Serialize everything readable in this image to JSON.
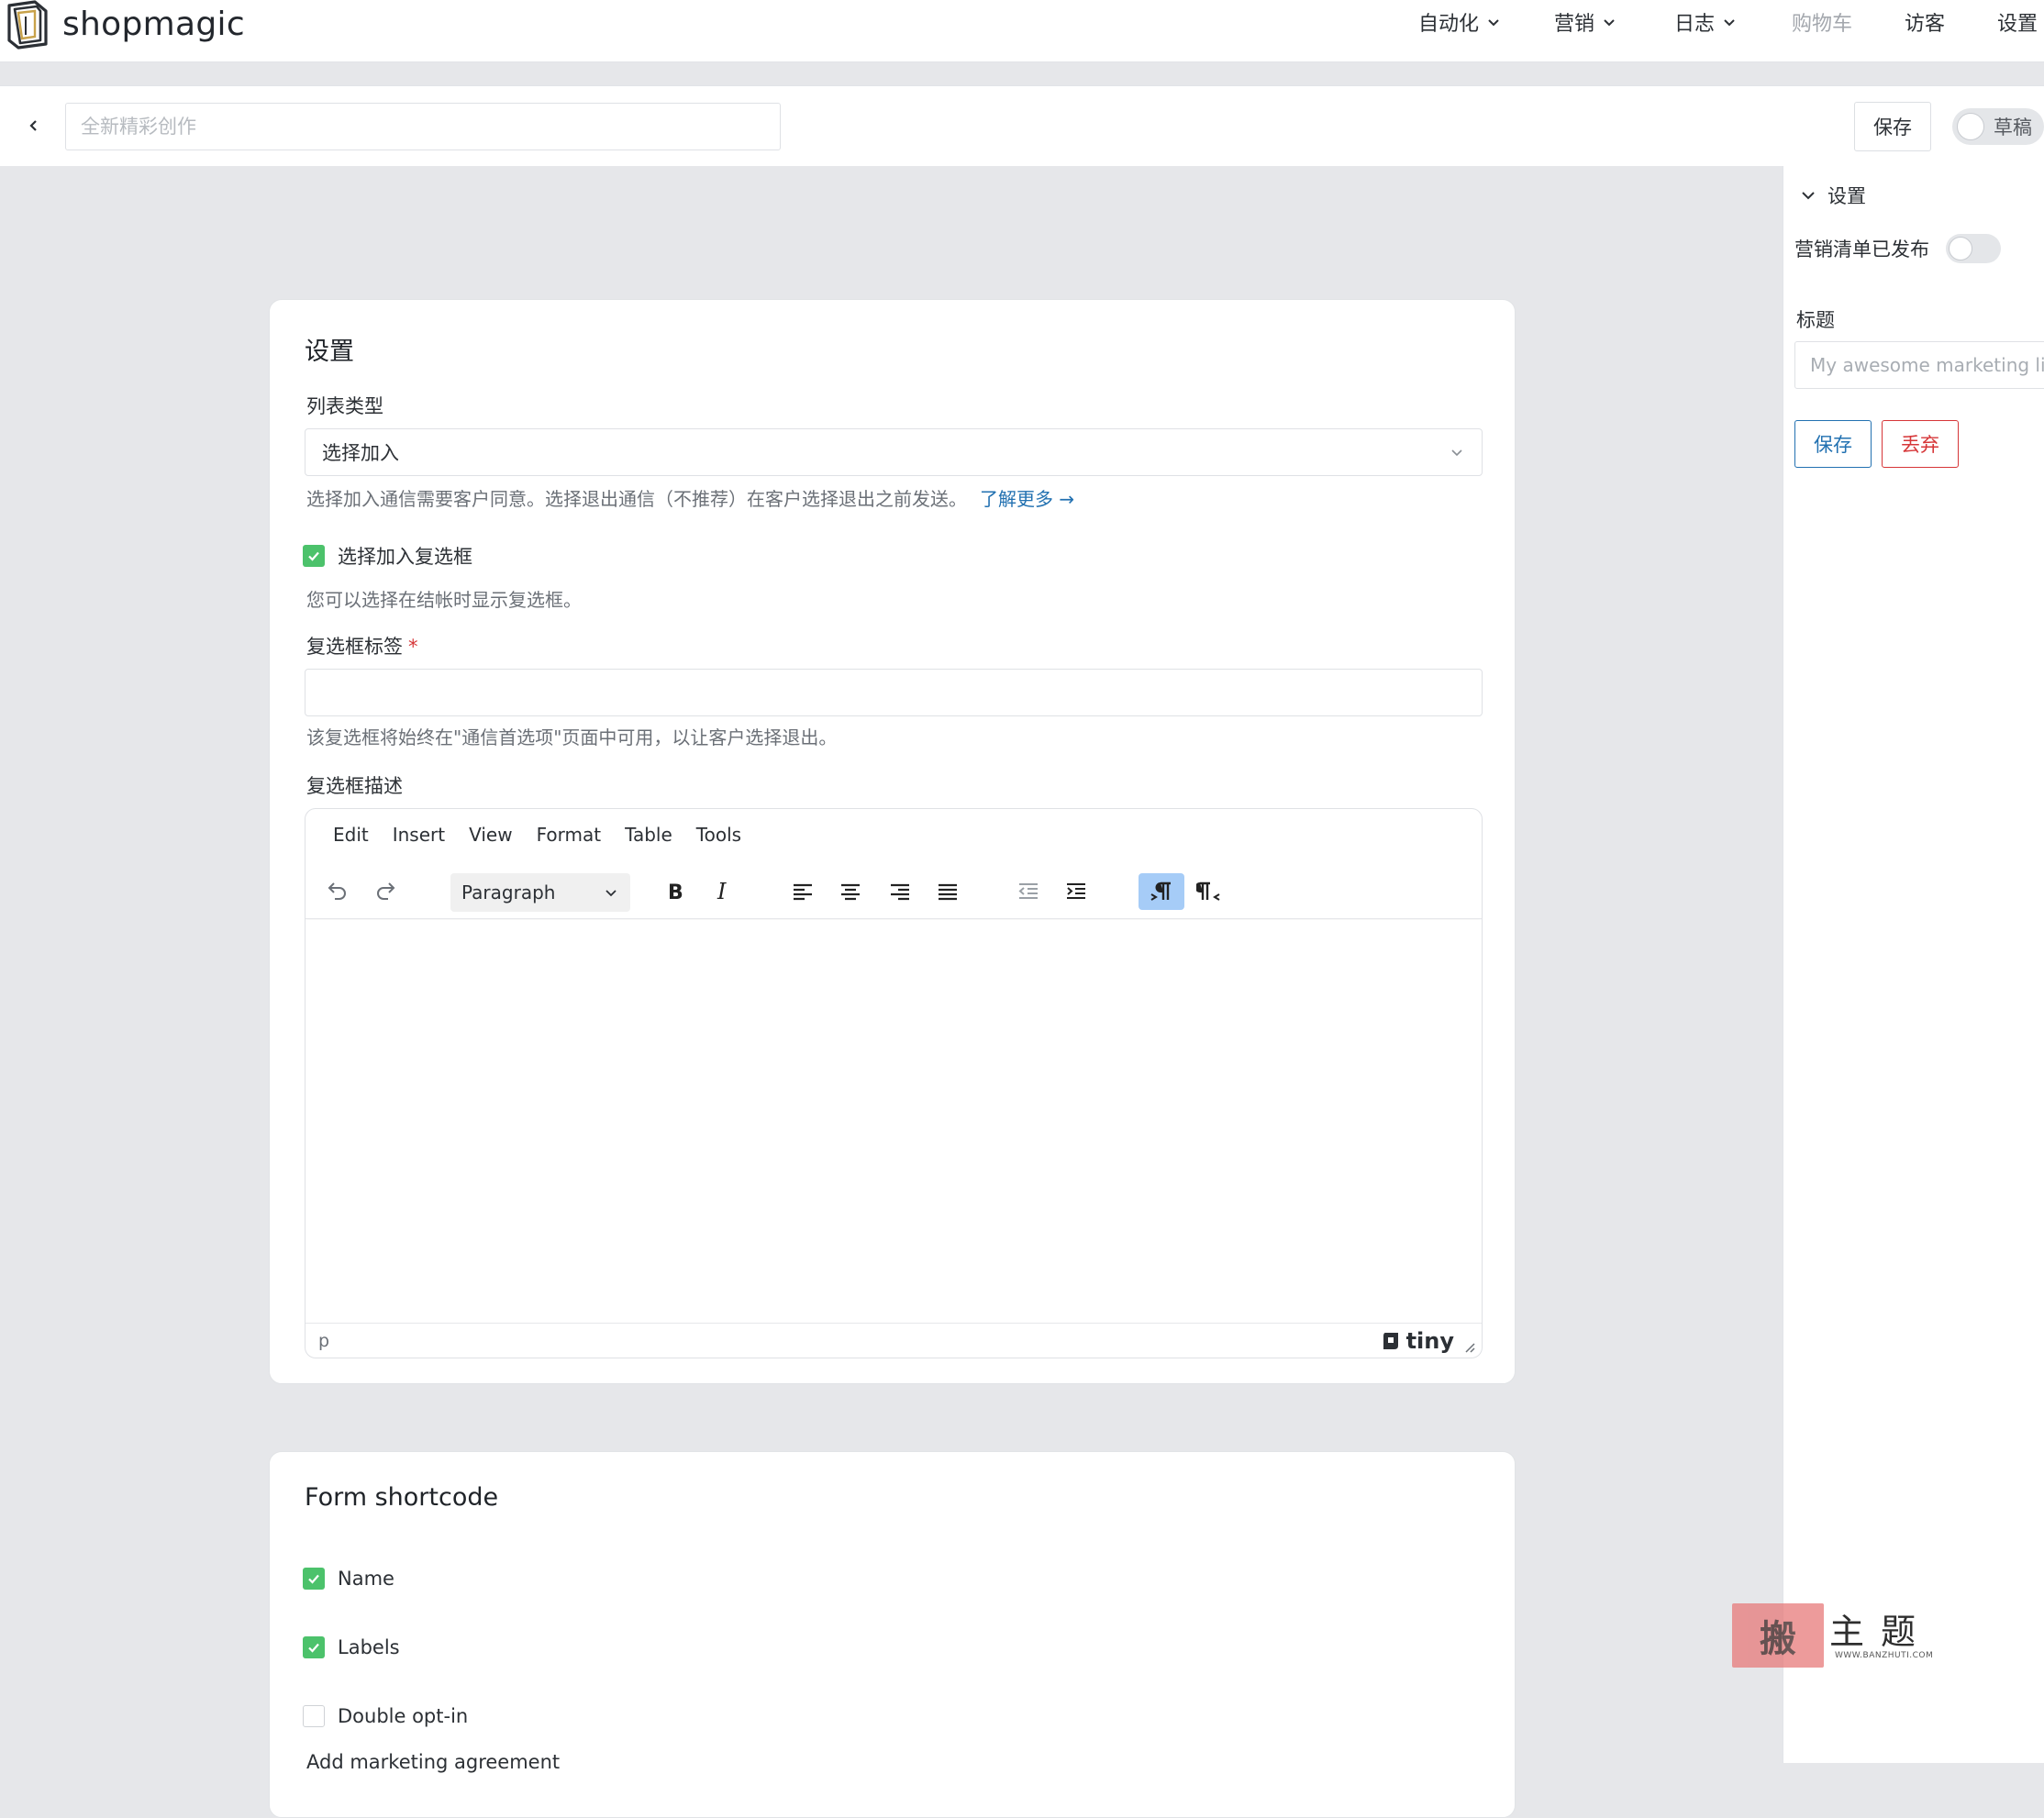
{
  "brand": {
    "name": "shopmagic"
  },
  "nav": {
    "items": [
      {
        "label": "自动化",
        "dropdown": true,
        "disabled": false
      },
      {
        "label": "营销",
        "dropdown": true,
        "disabled": false
      },
      {
        "label": "日志",
        "dropdown": true,
        "disabled": false
      },
      {
        "label": "购物车",
        "dropdown": false,
        "disabled": true
      },
      {
        "label": "访客",
        "dropdown": false,
        "disabled": false
      },
      {
        "label": "设置",
        "dropdown": false,
        "disabled": false
      }
    ]
  },
  "header": {
    "title_placeholder": "全新精彩创作",
    "save_label": "保存",
    "draft_label": "草稿",
    "draft_on": false
  },
  "sidebar": {
    "heading": "设置",
    "published_label": "营销清单已发布",
    "published_on": false,
    "title_label": "标题",
    "title_placeholder": "My awesome marketing list",
    "save_label": "保存",
    "discard_label": "丢弃"
  },
  "settings_card": {
    "title": "设置",
    "list_type_label": "列表类型",
    "list_type_value": "选择加入",
    "list_type_help": "选择加入通信需要客户同意。选择退出通信（不推荐）在客户选择退出之前发送。",
    "learn_more": "了解更多 →",
    "optin_checkbox_label": "选择加入复选框",
    "optin_checkbox_checked": true,
    "optin_checkbox_help": "您可以选择在结帐时显示复选框。",
    "checkbox_label_label": "复选框标签",
    "required_mark": "*",
    "checkbox_label_value": "",
    "checkbox_label_help": "该复选框将始终在\"通信首选项\"页面中可用，以让客户选择退出。",
    "checkbox_desc_label": "复选框描述"
  },
  "editor": {
    "menus": [
      "Edit",
      "Insert",
      "View",
      "Format",
      "Table",
      "Tools"
    ],
    "block_format": "Paragraph",
    "status_path": "p",
    "brand": "tiny",
    "ltr_active": true
  },
  "shortcode_card": {
    "title": "Form shortcode",
    "options": [
      {
        "label": "Name",
        "checked": true
      },
      {
        "label": "Labels",
        "checked": true
      },
      {
        "label": "Double opt-in",
        "checked": false
      }
    ],
    "cutoff_label": "Add marketing agreement"
  },
  "watermark": {
    "stamp": "搬",
    "chars": "主题",
    "url": "WWW.BANZHUTI.COM"
  },
  "colors": {
    "accent": "#2271b1",
    "danger": "#d63638",
    "checkbox": "#4cc26b",
    "page_bg": "#e6e7ea"
  }
}
